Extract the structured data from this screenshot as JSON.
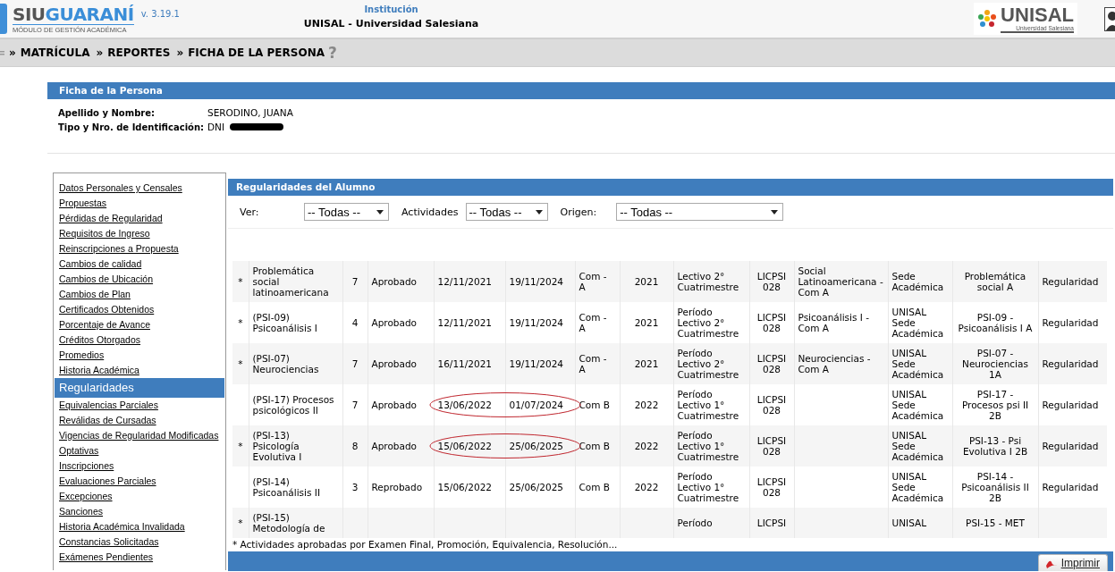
{
  "header": {
    "logo": {
      "brand_a": "SIU",
      "brand_b": "GUARANÍ",
      "subtitle": "MÓDULO DE GESTIÓN ACADÉMICA"
    },
    "version": "v. 3.19.1",
    "institution_label": "Institución",
    "institution": "UNISAL - Universidad Salesiana",
    "partner_logo": {
      "name": "UNISAL",
      "tagline": "Universidad Salesiana"
    }
  },
  "breadcrumb": {
    "items": [
      {
        "separator": "»",
        "label": "MATRÍCULA"
      },
      {
        "separator": "»",
        "label": "REPORTES"
      },
      {
        "separator": "»",
        "label": "FICHA DE LA PERSONA"
      }
    ],
    "help": "?"
  },
  "person": {
    "title": "Ficha de la Persona",
    "fields": [
      {
        "label": "Apellido y Nombre:",
        "value": "SERODINO, JUANA",
        "redacted": false
      },
      {
        "label": "Tipo y Nro. de Identificación:",
        "value": "DNI",
        "redacted": true
      }
    ]
  },
  "sidebar": {
    "items": [
      {
        "label": "Datos Personales y Censales",
        "selected": false
      },
      {
        "label": "Propuestas",
        "selected": false
      },
      {
        "label": "Pérdidas de Regularidad",
        "selected": false
      },
      {
        "label": "Requisitos de Ingreso",
        "selected": false
      },
      {
        "label": "Reinscripciones a Propuesta",
        "selected": false
      },
      {
        "label": "Cambios de calidad",
        "selected": false
      },
      {
        "label": "Cambios de Ubicación",
        "selected": false
      },
      {
        "label": "Cambios de Plan",
        "selected": false
      },
      {
        "label": "Certificados Obtenidos",
        "selected": false
      },
      {
        "label": "Porcentaje de Avance",
        "selected": false
      },
      {
        "label": "Créditos Otorgados",
        "selected": false
      },
      {
        "label": "Promedios",
        "selected": false
      },
      {
        "label": "Historia Académica",
        "selected": false
      },
      {
        "label": "Regularidades",
        "selected": true
      },
      {
        "label": "Equivalencias Parciales",
        "selected": false
      },
      {
        "label": "Reválidas de Cursadas",
        "selected": false
      },
      {
        "label": "Vigencias de Regularidad Modificadas",
        "selected": false
      },
      {
        "label": "Optativas",
        "selected": false
      },
      {
        "label": "Inscripciones",
        "selected": false
      },
      {
        "label": "Evaluaciones Parciales",
        "selected": false
      },
      {
        "label": "Excepciones",
        "selected": false
      },
      {
        "label": "Sanciones",
        "selected": false
      },
      {
        "label": "Historia Académica Invalidada",
        "selected": false
      },
      {
        "label": "Constancias Solicitadas",
        "selected": false
      },
      {
        "label": "Exámenes Pendientes",
        "selected": false
      }
    ]
  },
  "regularidades": {
    "title": "Regularidades del Alumno",
    "filters": [
      {
        "label": "Ver:",
        "value": "-- Todas --"
      },
      {
        "label": "Actividades",
        "value": "-- Todas --"
      },
      {
        "label": "Origen:",
        "value": "-- Todas --"
      }
    ],
    "table": {
      "rows": [
        {
          "circled": false,
          "column_1": "*",
          "column_2": "Problemática social latinoamericana",
          "column_3": "7",
          "column_4": "Aprobado",
          "column_5": "12/11/2021",
          "column_6": "19/11/2024",
          "column_7": "Com - A",
          "column_8": "2021",
          "column_9": "Lectivo 2° Cuatrimestre",
          "column_10": "LICPSI 028",
          "column_11": "Social Latinoamericana - Com A",
          "column_12": "Sede Académica",
          "column_13": "Problemática social A",
          "column_14": "Regularidad"
        },
        {
          "circled": false,
          "column_1": "*",
          "column_2": "(PSI-09) Psicoanálisis I",
          "column_3": "4",
          "column_4": "Aprobado",
          "column_5": "12/11/2021",
          "column_6": "19/11/2024",
          "column_7": "Com - A",
          "column_8": "2021",
          "column_9": "Período Lectivo 2° Cuatrimestre",
          "column_10": "LICPSI 028",
          "column_11": "Psicoanálisis I - Com A",
          "column_12": "UNISAL Sede Académica",
          "column_13": "PSI-09 - Psicoanálisis I A",
          "column_14": "Regularidad"
        },
        {
          "circled": false,
          "column_1": "*",
          "column_2": "(PSI-07) Neurociencias",
          "column_3": "7",
          "column_4": "Aprobado",
          "column_5": "16/11/2021",
          "column_6": "19/11/2024",
          "column_7": "Com - A",
          "column_8": "2021",
          "column_9": "Período Lectivo 2° Cuatrimestre",
          "column_10": "LICPSI 028",
          "column_11": "Neurociencias - Com A",
          "column_12": "UNISAL Sede Académica",
          "column_13": "PSI-07 - Neurociencias 1A",
          "column_14": "Regularidad"
        },
        {
          "circled": true,
          "column_2": "(PSI-17) Procesos psicológicos II",
          "column_3": "7",
          "column_4": "Aprobado",
          "column_5": "13/06/2022",
          "column_6": "01/07/2024",
          "column_7": "Com B",
          "column_8": "2022",
          "column_9": "Período Lectivo 1° Cuatrimestre",
          "column_10": "LICPSI 028",
          "column_12": "UNISAL Sede Académica",
          "column_13": "PSI-17 - Procesos psi II 2B",
          "column_14": "Regularidad"
        },
        {
          "circled": true,
          "column_1": "*",
          "column_2": "(PSI-13) Psicología Evolutiva I",
          "column_3": "8",
          "column_4": "Aprobado",
          "column_5": "15/06/2022",
          "column_6": "25/06/2025",
          "column_7": "Com B",
          "column_8": "2022",
          "column_9": "Período Lectivo 1° Cuatrimestre",
          "column_10": "LICPSI 028",
          "column_12": "UNISAL Sede Académica",
          "column_13": "PSI-13 - Psi Evolutiva I 2B",
          "column_14": "Regularidad"
        },
        {
          "circled": false,
          "column_2": "(PSI-14) Psicoanálisis II",
          "column_3": "3",
          "column_4": "Reprobado",
          "column_5": "15/06/2022",
          "column_6": "25/06/2025",
          "column_7": "Com B",
          "column_8": "2022",
          "column_9": "Período Lectivo 1° Cuatrimestre",
          "column_10": "LICPSI 028",
          "column_12": "UNISAL Sede Académica",
          "column_13": "PSI-14 - Psicoanálisis II 2B",
          "column_14": "Regularidad"
        },
        {
          "circled": false,
          "column_1": "*",
          "column_2": "(PSI-15) Metodología de",
          "column_9": "Período",
          "column_10": "LICPSI",
          "column_12": "UNISAL",
          "column_13": "PSI-15 - MET"
        }
      ]
    },
    "footnote": "* Actividades aprobadas por Examen Final, Promoción, Equivalencia, Resolución...",
    "print_button": "Imprimir"
  }
}
